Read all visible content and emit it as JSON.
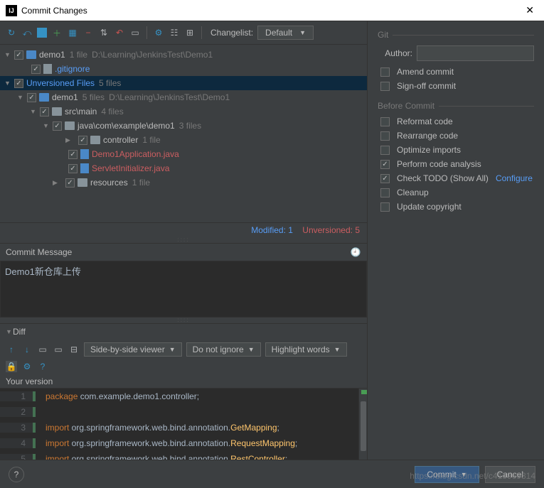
{
  "window": {
    "title": "Commit Changes"
  },
  "changelist": {
    "label": "Changelist:",
    "value": "Default"
  },
  "tree": {
    "demo1": {
      "name": "demo1",
      "meta": "1 file",
      "path": "D:\\Learning\\JenkinsTest\\Demo1"
    },
    "gitignore": ".gitignore",
    "unversioned": {
      "label": "Unversioned Files",
      "meta": "5 files"
    },
    "demo1b": {
      "name": "demo1",
      "meta": "5 files",
      "path": "D:\\Learning\\JenkinsTest\\Demo1"
    },
    "srcmain": {
      "name": "src\\main",
      "meta": "4 files"
    },
    "javapkg": {
      "name": "java\\com\\example\\demo1",
      "meta": "3 files"
    },
    "controller": {
      "name": "controller",
      "meta": "1 file"
    },
    "app": "Demo1Application.java",
    "servlet": "ServletInitializer.java",
    "resources": {
      "name": "resources",
      "meta": "1 file"
    }
  },
  "status": {
    "modified": "Modified: 1",
    "unversioned": "Unversioned: 5"
  },
  "commit_message": {
    "label": "Commit Message",
    "value": "Demo1新仓库上传"
  },
  "diff": {
    "label": "Diff",
    "viewer": "Side-by-side viewer",
    "ignore": "Do not ignore",
    "highlight": "Highlight words",
    "your_version": "Your version"
  },
  "code": {
    "l1_kw": "package",
    "l1_rest": " com.example.demo1.controller;",
    "l3_kw": "import",
    "l3_mid": " org.springframework.web.bind.annotation.",
    "l3_cls": "GetMapping",
    "l3_end": ";",
    "l4_kw": "import",
    "l4_mid": " org.springframework.web.bind.annotation.",
    "l4_cls": "RequestMapping",
    "l4_end": ";",
    "l5_kw": "import",
    "l5_mid": " org.springframework.web.bind.annotation.",
    "l5_cls": "RestController",
    "l5_end": ";"
  },
  "git": {
    "section": "Git",
    "author_label": "Author:",
    "amend": "Amend commit",
    "signoff": "Sign-off commit"
  },
  "before": {
    "section": "Before Commit",
    "reformat": "Reformat code",
    "rearrange": "Rearrange code",
    "optimize": "Optimize imports",
    "analysis": "Perform code analysis",
    "todo": "Check TODO (Show All)",
    "configure": "Configure",
    "cleanup": "Cleanup",
    "copyright": "Update copyright"
  },
  "buttons": {
    "commit": "Commit",
    "cancel": "Cancel",
    "help": "?"
  },
  "watermark": "https://blog.csdn.net/c413969814"
}
